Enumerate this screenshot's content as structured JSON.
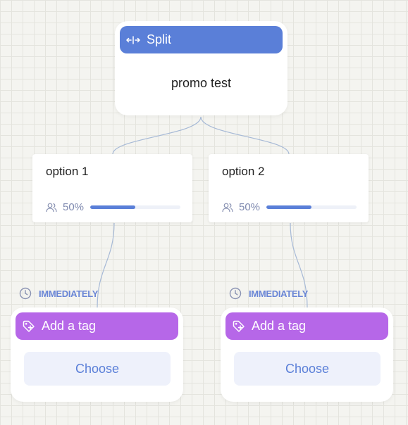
{
  "split": {
    "title": "Split",
    "name": "promo test"
  },
  "options": [
    {
      "label": "option 1",
      "percent_text": "50%",
      "percent": 0.5
    },
    {
      "label": "option 2",
      "percent_text": "50%",
      "percent": 0.5
    }
  ],
  "branches": [
    {
      "timing": "IMMEDIATELY",
      "action_title": "Add a tag",
      "button_label": "Choose"
    },
    {
      "timing": "IMMEDIATELY",
      "action_title": "Add a tag",
      "button_label": "Choose"
    }
  ],
  "colors": {
    "split_header": "#5a7fd8",
    "action_header": "#b667e8",
    "progress": "#5a7fd8",
    "connector": "#a6b9d6",
    "timing_text": "#6a86d6"
  },
  "icons": {
    "split": "split-arrows-icon",
    "users": "users-icon",
    "clock": "clock-icon",
    "tag": "tag-plus-icon"
  }
}
